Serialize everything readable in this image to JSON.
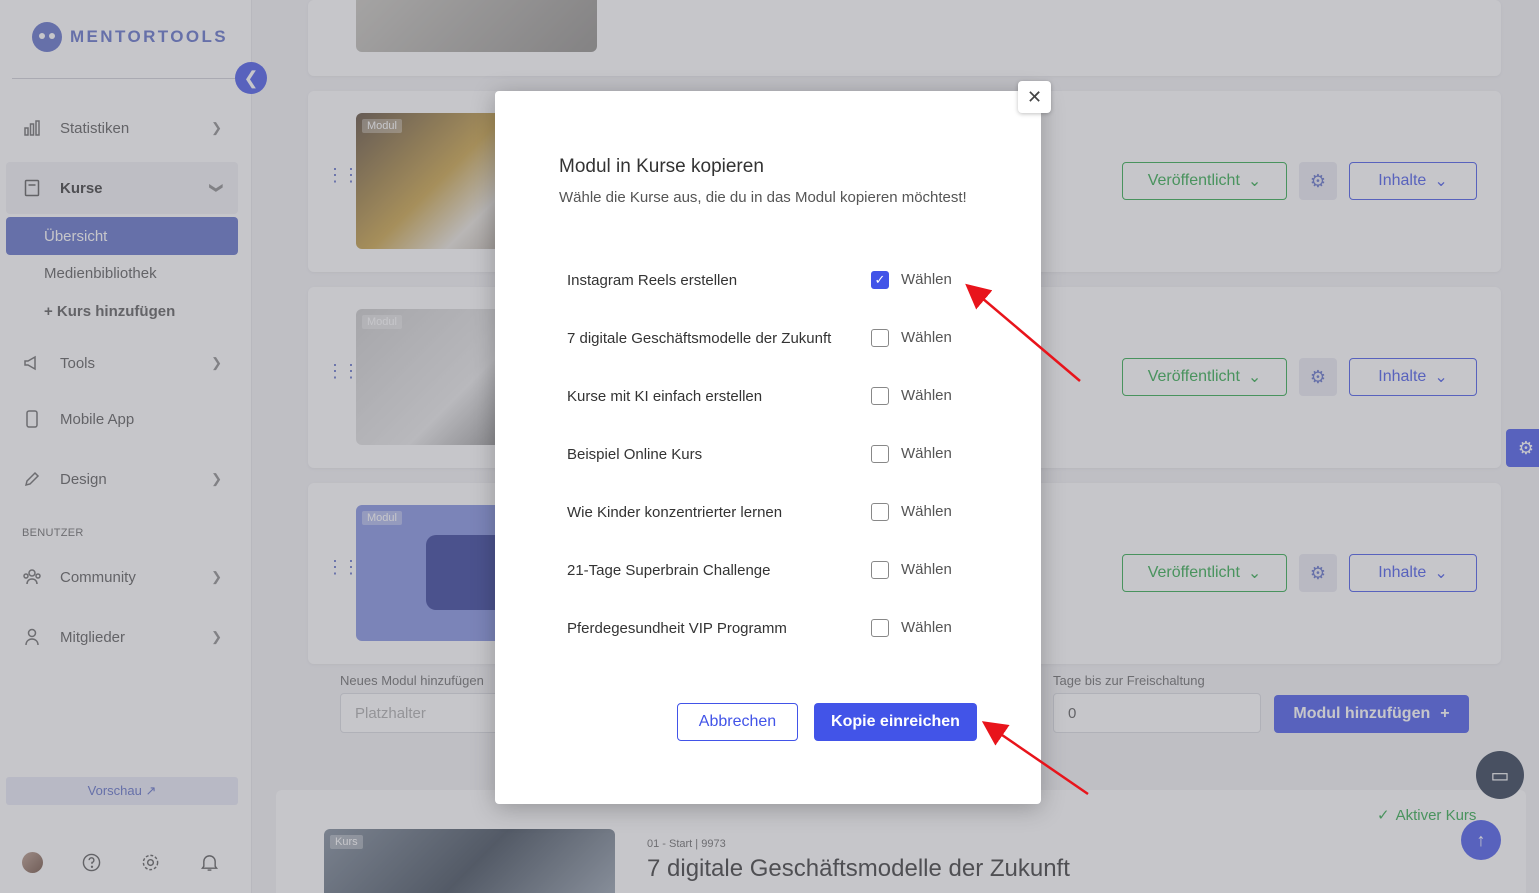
{
  "brand": {
    "name": "MENTORTOOLS"
  },
  "sidebar": {
    "items": [
      {
        "label": "Statistiken",
        "icon": "chart-icon"
      },
      {
        "label": "Kurse",
        "icon": "book-icon"
      },
      {
        "label": "Tools",
        "icon": "megaphone-icon"
      },
      {
        "label": "Mobile App",
        "icon": "phone-icon"
      },
      {
        "label": "Design",
        "icon": "edit-icon"
      },
      {
        "label": "Community",
        "icon": "people-icon"
      },
      {
        "label": "Mitglieder",
        "icon": "user-icon"
      }
    ],
    "subitems": [
      "Übersicht",
      "Medienbibliothek",
      "+ Kurs hinzufügen"
    ],
    "section_label": "BENUTZER",
    "preview_label": "Vorschau ↗"
  },
  "modules": [
    {
      "badge": "Modul",
      "status": "Veröffentlicht",
      "content": "Inhalte"
    },
    {
      "badge": "Modul",
      "status": "Veröffentlicht",
      "content": "Inhalte"
    },
    {
      "badge": "Modul",
      "status": "Veröffentlicht",
      "content": "Inhalte"
    }
  ],
  "form": {
    "new_module_label": "Neues Modul hinzufügen",
    "new_module_placeholder": "Platzhalter",
    "days_label": "Tage bis zur Freischaltung",
    "days_value": "0",
    "add_button": "Modul hinzufügen"
  },
  "course": {
    "badge": "Kurs",
    "meta": "01 - Start | 9973",
    "title": "7 digitale Geschäftsmodelle der Zukunft",
    "active": "Aktiver Kurs"
  },
  "modal": {
    "title": "Modul in Kurse kopieren",
    "subtitle": "Wähle die Kurse aus, die du in das Modul kopieren möchtest!",
    "options": [
      {
        "name": "Instagram Reels erstellen",
        "label": "Wählen",
        "checked": true
      },
      {
        "name": "7 digitale Geschäftsmodelle der Zukunft",
        "label": "Wählen",
        "checked": false
      },
      {
        "name": "Kurse mit KI einfach erstellen",
        "label": "Wählen",
        "checked": false
      },
      {
        "name": "Beispiel Online Kurs",
        "label": "Wählen",
        "checked": false
      },
      {
        "name": "Wie Kinder konzentrierter lernen",
        "label": "Wählen",
        "checked": false
      },
      {
        "name": "21-Tage Superbrain Challenge",
        "label": "Wählen",
        "checked": false
      },
      {
        "name": "Pferdegesundheit VIP Programm",
        "label": "Wählen",
        "checked": false
      }
    ],
    "cancel": "Abbrechen",
    "submit": "Kopie einreichen"
  },
  "colors": {
    "accent": "#4254e8",
    "brand": "#5b6bc7",
    "success": "#29a745",
    "annotation": "#e8141b"
  }
}
